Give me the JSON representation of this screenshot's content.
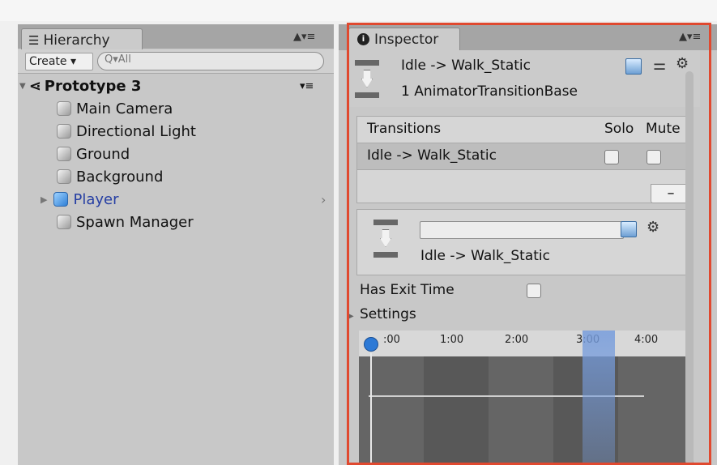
{
  "hierarchy": {
    "tab_label": "Hierarchy",
    "tab_menu": "▲▾≡",
    "create_label": "Create ▾",
    "search_placeholder": "Q▾All",
    "scene": {
      "name": "Prototype 3",
      "menu": "▾≡"
    },
    "items": [
      {
        "label": "Main Camera"
      },
      {
        "label": "Directional Light"
      },
      {
        "label": "Ground"
      },
      {
        "label": "Background"
      },
      {
        "label": "Player"
      },
      {
        "label": "Spawn Manager"
      }
    ]
  },
  "inspector": {
    "tab_label": "Inspector",
    "tab_menu": "▲▾≡",
    "header": {
      "title": "Idle -> Walk_Static",
      "subtitle": "1 AnimatorTransitionBase"
    },
    "transitions": {
      "columns": [
        "Transitions",
        "Solo",
        "Mute"
      ],
      "row": "Idle -> Walk_Static",
      "minus": "–"
    },
    "transition": {
      "name_value": "",
      "title": "Idle -> Walk_Static"
    },
    "fields": {
      "has_exit_time": "Has Exit Time",
      "settings": "Settings"
    },
    "timeline": {
      "ticks": [
        ":00",
        "1:00",
        "2:00",
        "3:00",
        "4:00"
      ]
    }
  },
  "colors": {
    "selection_frame": "#e0492f",
    "timeline_highlight": "#769cdc"
  }
}
